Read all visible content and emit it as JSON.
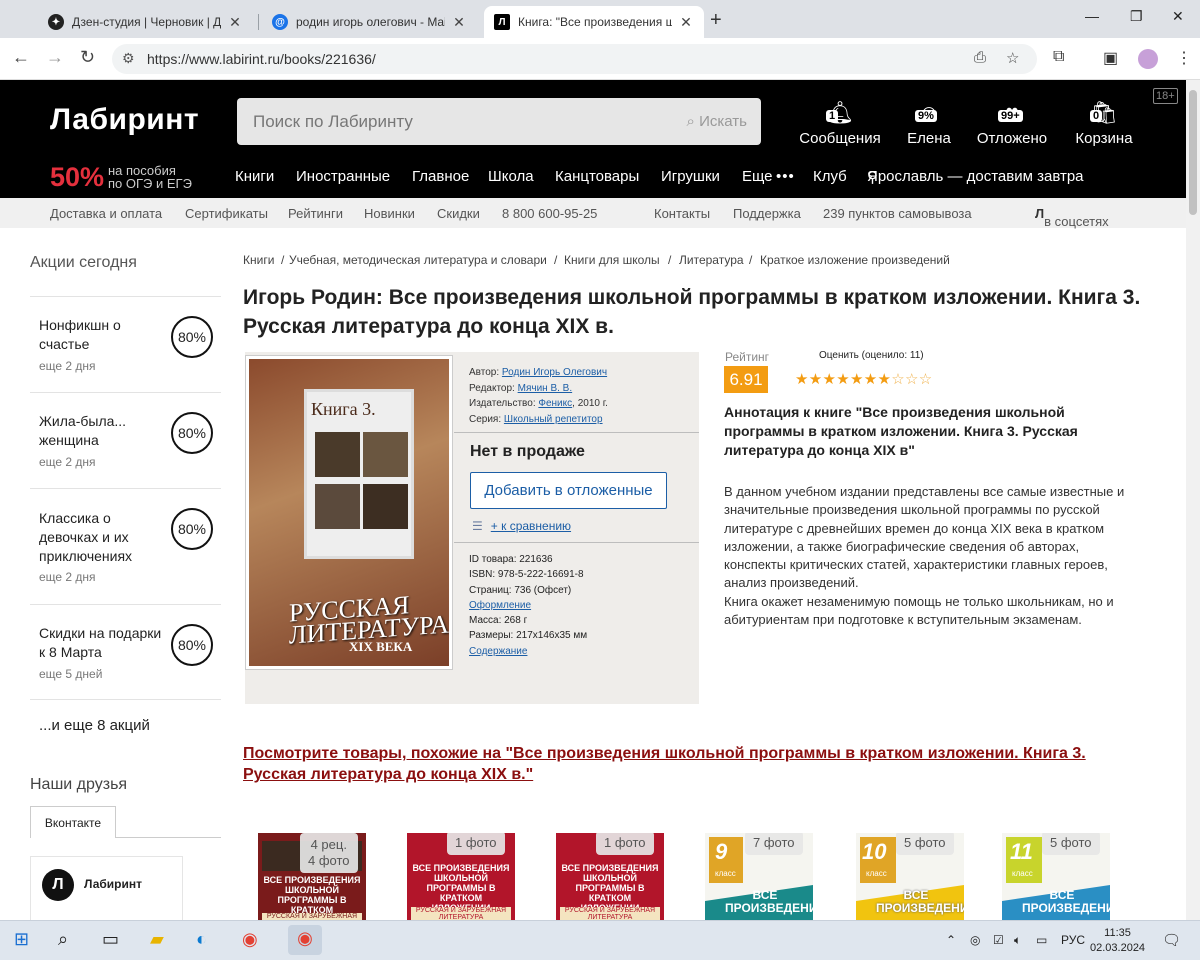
{
  "browser": {
    "tabs": [
      {
        "title": "Дзен-студия | Черновик | Дзен",
        "icon": "dzen-icon"
      },
      {
        "title": "родин игорь олегович - Mail.r",
        "icon": "mail-icon"
      },
      {
        "title": "Книга: \"Все произведения шко",
        "icon": "labirint-icon"
      }
    ],
    "url": "https://www.labirint.ru/books/221636/"
  },
  "header": {
    "logo": "Лабиринт",
    "search_placeholder": "Поиск по Лабиринту",
    "search_button": "Искать",
    "icons": [
      {
        "label": "Сообщения",
        "badge": "1",
        "icon": "bell-icon"
      },
      {
        "label": "Елена",
        "badge": "9%",
        "icon": "user-icon"
      },
      {
        "label": "Отложено",
        "badge": "99+",
        "icon": "heart-icon"
      },
      {
        "label": "Корзина",
        "badge": "0",
        "icon": "cart-icon"
      }
    ],
    "age": "18+",
    "promo_percent": "50%",
    "promo_line1": "на пособия",
    "promo_line2": "по ОГЭ и ЕГЭ",
    "nav": [
      "Книги",
      "Иностранные",
      "Главное",
      "Школа",
      "Канцтовары",
      "Игрушки",
      "Еще",
      "•••",
      "Клуб",
      "Ярославль — доставим завтра"
    ]
  },
  "subnav": [
    "Доставка и оплата",
    "Сертификаты",
    "Рейтинги",
    "Новинки",
    "Скидки",
    "8 800 600-95-25",
    "Контакты",
    "Поддержка",
    "239 пунктов самовывоза",
    "в соцсетях"
  ],
  "sidebar": {
    "title": "Акции сегодня",
    "promos": [
      {
        "name": "Нонфикшн о счастье",
        "days": "еще 2 дня",
        "discount": "80%"
      },
      {
        "name": "Жила-была... женщина",
        "days": "еще 2 дня",
        "discount": "80%"
      },
      {
        "name": "Классика о девочках и их приключениях",
        "days": "еще 2 дня",
        "discount": "80%"
      },
      {
        "name": "Скидки на подарки к 8 Марта",
        "days": "еще 5 дней",
        "discount": "80%"
      }
    ],
    "more": "...и еще 8 акций",
    "friends_title": "Наши друзья",
    "vk_tab": "Вконтакте",
    "vk_name": "Лабиринт"
  },
  "breadcrumbs": [
    "Книги",
    "Учебная, методическая литература и словари",
    "Книги для школы",
    "Литература",
    "Краткое изложение произведений"
  ],
  "book": {
    "title": "Игорь Родин: Все произведения школьной программы в кратком изложении. Книга 3. Русская литература до конца XIX в.",
    "cover_book_label": "Книга 3.",
    "cover_title_1": "РУССКАЯ",
    "cover_title_2": "ЛИТЕРАТУРА",
    "cover_subtitle": "XIX ВЕКА",
    "author_label": "Автор:",
    "author": "Родин Игорь Олегович",
    "editor_label": "Редактор:",
    "editor": "Мячин В. В.",
    "publisher_label": "Издательство:",
    "publisher": "Феникс",
    "year": ", 2010 г.",
    "series_label": "Серия:",
    "series": "Школьный репетитор",
    "availability": "Нет в продаже",
    "add_button": "Добавить в отложенные",
    "compare": "+ к сравнению",
    "id": "ID товара: 221636",
    "isbn": "ISBN: 978-5-222-16691-8",
    "pages": "Страниц: 736 (Офсет)",
    "design_link": "Оформление",
    "weight": "Масса: 268 г",
    "size": "Размеры: 217x146x35 мм",
    "contents_link": "Содержание",
    "rating_label": "Рейтинг",
    "rating": "6.91",
    "rate_prompt": "Оценить (оценило: 11)",
    "stars": "★★★★★★★☆☆☆",
    "stars_filled": 7,
    "annotation_title": "Аннотация к книге \"Все произведения школьной программы в кратком изложении. Книга 3. Русская литература до конца XIX в\"",
    "annotation_p1": "В данном учебном издании представлены все самые известные и значительные произведения школьной программы по русской литературе с древнейших времен до конца XIX века в кратком изложении, а также биографические сведения об авторах, конспекты критических статей, характеристики главных героев, анализ произведений.",
    "annotation_p2": "Книга окажет незаменимую помощь не только школьникам, но и абитуриентам при подготовке к вступительным экзаменам."
  },
  "similar_title": "Посмотрите товары, похожие на \"Все произведения школьной программы в кратком изложении. Книга 3. Русская литература до конца XIX в.\"",
  "products": [
    {
      "badge": "4 рец.\n4 фото",
      "cover_text": "ВСЕ ПРОИЗВЕДЕНИЯ ШКОЛЬНОЙ ПРОГРАММЫ В КРАТКОМ ИЗЛОЖЕНИИ",
      "cover_sub": "РУССКАЯ И ЗАРУБЕЖНАЯ"
    },
    {
      "badge": "1 фото",
      "cover_text": "ВСЕ ПРОИЗВЕДЕНИЯ ШКОЛЬНОЙ ПРОГРАММЫ В КРАТКОМ ИЗЛОЖЕНИИ",
      "cover_sub": "РУССКАЯ И ЗАРУБЕЖНАЯ ЛИТЕРАТУРА"
    },
    {
      "badge": "1 фото",
      "cover_text": "ВСЕ ПРОИЗВЕДЕНИЯ ШКОЛЬНОЙ ПРОГРАММЫ В КРАТКОМ ИЗЛОЖЕНИИ",
      "cover_sub": "РУССКАЯ И ЗАРУБЕЖНАЯ ЛИТЕРАТУРА"
    },
    {
      "badge": "7 фото",
      "grade": "9",
      "grade_word": "класс",
      "cover_text": "ВСЕ ПРОИЗВЕДЕНИЯ"
    },
    {
      "badge": "5 фото",
      "grade": "10",
      "grade_word": "класс",
      "cover_text": "ВСЕ ПРОИЗВЕДЕНИЯ"
    },
    {
      "badge": "5 фото",
      "grade": "11",
      "grade_word": "класс",
      "cover_text": "ВСЕ ПРОИЗВЕДЕНИЯ"
    }
  ],
  "taskbar": {
    "lang": "РУС",
    "time": "11:35",
    "date": "02.03.2024"
  },
  "colors": {
    "accent": "#f39c12",
    "header": "#000000",
    "promo_red": "#e5303d",
    "link": "#1c5ea6",
    "similar": "#8b0f0f"
  }
}
